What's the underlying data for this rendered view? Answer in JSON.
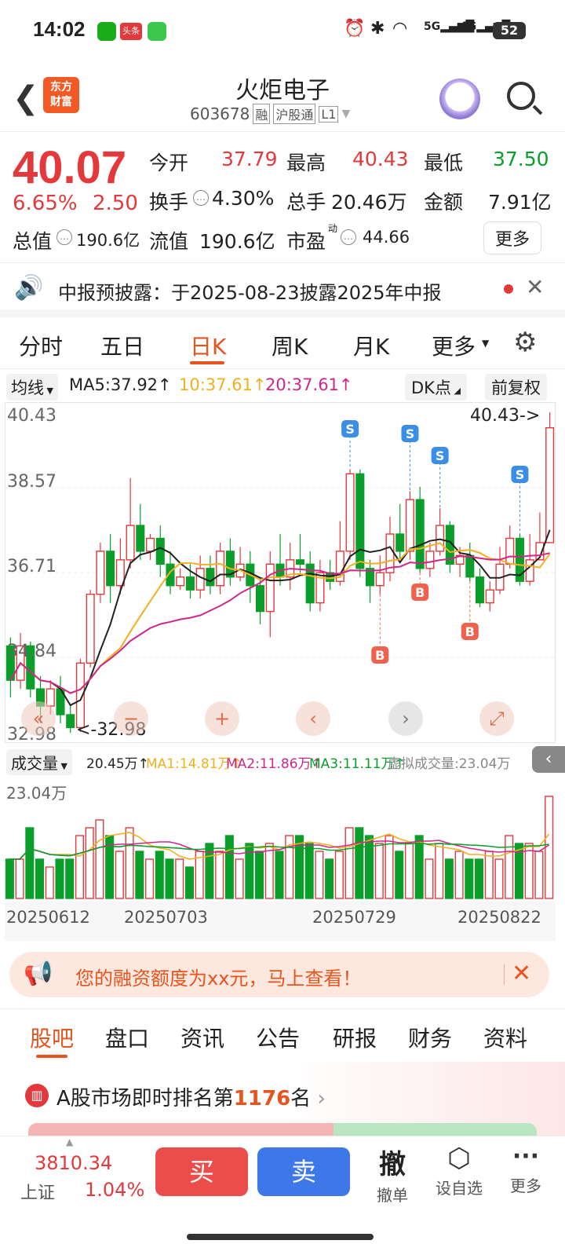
{
  "status_bar": {
    "time": "14:02",
    "badge": "头条",
    "battery": "52"
  },
  "header": {
    "title": "火炬电子",
    "code": "603678",
    "tag1": "融",
    "tag2": "沪股通",
    "tag3": "L1",
    "logo_top": "东方",
    "logo_bottom": "财富"
  },
  "quote": {
    "price": "40.07",
    "change_pct": "6.65%",
    "change": "2.50",
    "open_label": "今开",
    "open": "37.79",
    "high_label": "最高",
    "high": "40.43",
    "low_label": "最低",
    "low": "37.50",
    "turnover_label": "换手",
    "turnover": "4.30%",
    "volume_label": "总手",
    "volume": "20.46万",
    "amount_label": "金额",
    "amount": "7.91亿",
    "mktcap_label": "总值",
    "mktcap": "190.6亿",
    "float_label": "流值",
    "float": "190.6亿",
    "pe_label": "市盈",
    "pe_sup": "动",
    "pe": "44.66",
    "more": "更多"
  },
  "notice": {
    "text": "中报预披露：于2025-08-23披露2025年中报"
  },
  "chart_tabs": [
    "分时",
    "五日",
    "日K",
    "周K",
    "月K",
    "更多"
  ],
  "active_tab": "日K",
  "ma_bar": {
    "selector": "均线",
    "ma5": "MA5:37.92↑",
    "ma10": "10:37.61↑",
    "ma20": "20:37.61↑",
    "dk": "DK点",
    "adjust": "前复权"
  },
  "chart_data": {
    "type": "candlestick",
    "y_ticks": [
      "40.43",
      "38.57",
      "36.71",
      "34.84",
      "32.98"
    ],
    "high_marker": "40.43->",
    "low_marker": "<-32.98",
    "signal_s": "S",
    "signal_b": "B",
    "x_ticks": [
      "20250612",
      "20250703",
      "20250729",
      "20250822"
    ]
  },
  "volume_bar": {
    "selector": "成交量",
    "vol": "20.45万↑",
    "ma1": "MA1:14.81万↑",
    "ma2": "MA2:11.86万↑",
    "ma3": "MA3:11.11万↑",
    "virtual": "虚拟成交量:23.04万",
    "axis_max": "23.04万"
  },
  "promo": {
    "text": "您的融资额度为xx元，马上查看！"
  },
  "info_tabs": [
    "股吧",
    "盘口",
    "资讯",
    "公告",
    "研报",
    "财务",
    "资料"
  ],
  "ranking": {
    "prefix": "A股市场即时排名第",
    "rank": "1176",
    "suffix": "名"
  },
  "bottom": {
    "index_value": "3810.34",
    "index_name": "上证",
    "index_pct": "1.04%",
    "buy": "买",
    "sell": "卖",
    "cancel_icon": "撤",
    "cancel": "撤单",
    "watch": "设自选",
    "more": "更多"
  },
  "colors": {
    "up": "#e4393c",
    "down": "#0a9e2b",
    "accent": "#e8541e",
    "ma5": "#222222",
    "ma10": "#f2b01e",
    "ma20": "#d0268a"
  }
}
